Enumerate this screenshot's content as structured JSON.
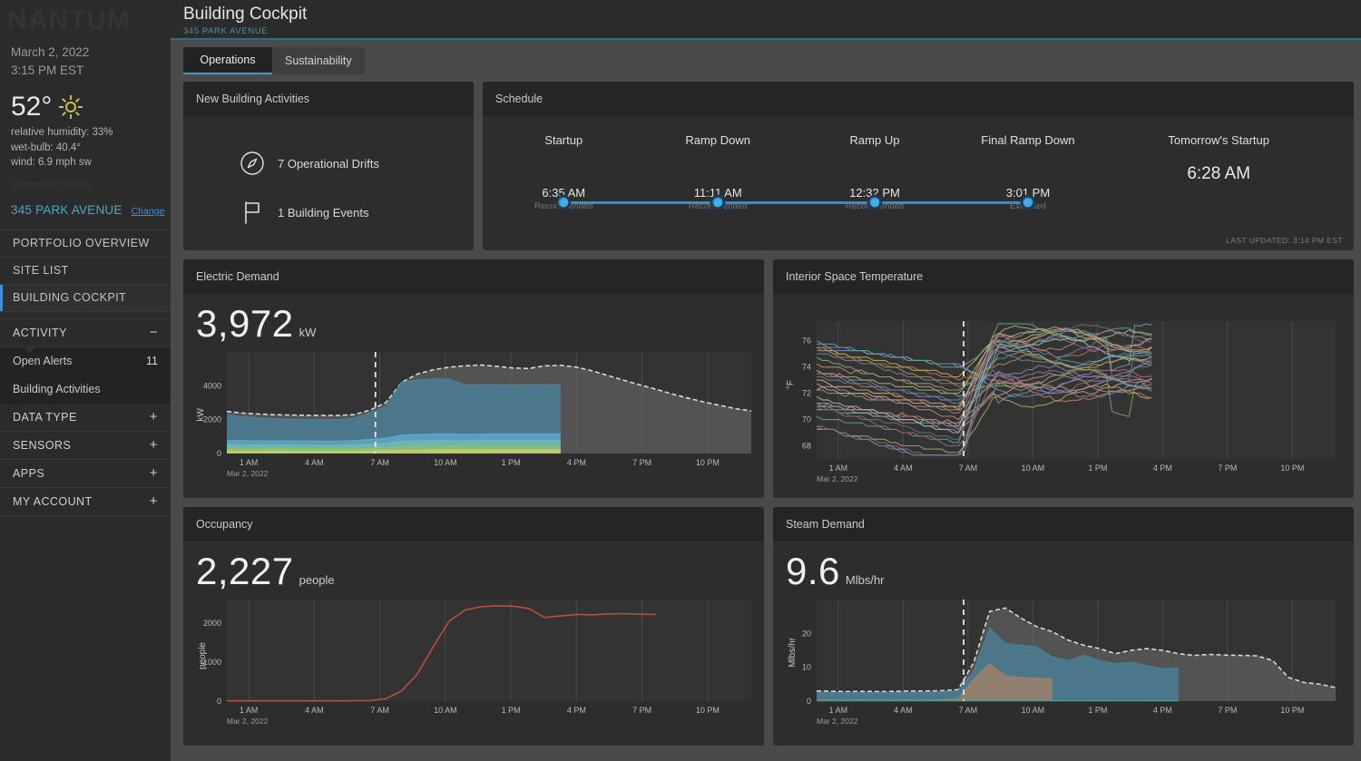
{
  "sidebar": {
    "logo": "NANTUM",
    "date": "March 2, 2022",
    "time": "3:15 PM EST",
    "weather": {
      "temp": "52°",
      "icon": "sun-icon",
      "humidity": "relative humidity: 33%",
      "wetbulb": "wet-bulb: 40.4°",
      "wind": "wind: 6.9 mph sw",
      "credit": "*powered by Dark Sky"
    },
    "site": {
      "name": "345 PARK AVENUE",
      "change": "Change"
    },
    "nav": [
      {
        "label": "PORTFOLIO OVERVIEW",
        "active": false
      },
      {
        "label": "SITE LIST",
        "active": false
      },
      {
        "label": "BUILDING COCKPIT",
        "active": true
      }
    ],
    "sections": [
      {
        "label": "ACTIVITY",
        "toggle": "−",
        "expanded": true,
        "items": [
          {
            "label": "Open Alerts",
            "count": "11"
          },
          {
            "label": "Building Activities",
            "count": ""
          }
        ]
      },
      {
        "label": "DATA TYPE",
        "toggle": "+",
        "expanded": false,
        "items": []
      },
      {
        "label": "SENSORS",
        "toggle": "+",
        "expanded": false,
        "items": []
      },
      {
        "label": "APPS",
        "toggle": "+",
        "expanded": false,
        "items": []
      },
      {
        "label": "MY ACCOUNT",
        "toggle": "+",
        "expanded": false,
        "items": []
      }
    ]
  },
  "header": {
    "title": "Building Cockpit",
    "subtitle": "345 PARK AVENUE"
  },
  "tabs": [
    {
      "label": "Operations",
      "active": true
    },
    {
      "label": "Sustainability",
      "active": false
    }
  ],
  "activities": {
    "title": "New Building Activities",
    "rows": [
      {
        "icon": "compass-icon",
        "label": "7 Operational Drifts"
      },
      {
        "icon": "flag-icon",
        "label": "1 Building Events"
      }
    ]
  },
  "schedule": {
    "title": "Schedule",
    "last_updated": "LAST UPDATED: 3:14 PM EST",
    "events": [
      {
        "name": "Startup",
        "time": "6:35 AM",
        "state": "Recommended"
      },
      {
        "name": "Ramp Down",
        "time": "11:11 AM",
        "state": "Recommended"
      },
      {
        "name": "Ramp Up",
        "time": "12:32 PM",
        "state": "Recommended"
      },
      {
        "name": "Final Ramp Down",
        "time": "3:01 PM",
        "state": "Executed"
      }
    ],
    "tomorrow": {
      "name": "Tomorrow's Startup",
      "time": "6:28 AM"
    }
  },
  "colors": {
    "accent_blue": "#3d9bd6",
    "track_blue": "#2e90cf",
    "site_teal": "#4ba8c4",
    "sidebar_bg": "#2b2b2b",
    "card_bg": "#2d2d2d",
    "card_header_bg": "#252525",
    "main_bg": "#4a4a4a",
    "occupancy_line": "#b5503f",
    "forecast_gray": "#6e6e6e"
  },
  "chart_data": [
    {
      "type": "area",
      "id": "electric-demand",
      "title": "Electric Demand",
      "value": "3,972",
      "unit": "kW",
      "ylabel": "kW",
      "xlabel": "",
      "date_label": "Mar 2, 2022",
      "ylim": [
        0,
        6000
      ],
      "yticks": [
        0,
        2000,
        4000
      ],
      "ytick_labels": [
        "0",
        "2000",
        "4000"
      ],
      "xticks": [
        "1 AM",
        "4 AM",
        "7 AM",
        "10 AM",
        "1 PM",
        "4 PM",
        "7 PM",
        "10 PM"
      ],
      "grid": true,
      "now_marker": "7 AM",
      "series": [
        {
          "name": "Forecast Total",
          "style": "dashed-area",
          "color": "#6e6e6e",
          "values": [
            2480,
            2390,
            2330,
            2290,
            2270,
            2255,
            2250,
            2245,
            2300,
            2560,
            3000,
            4200,
            4700,
            4950,
            5100,
            5180,
            5230,
            5150,
            5050,
            5020,
            5180,
            5210,
            5100,
            4880,
            4600,
            4320,
            4050,
            3800,
            3520,
            3280,
            3050,
            2850,
            2650,
            2520
          ]
        },
        {
          "name": "Actual Total",
          "style": "area",
          "color": "#4a7f96",
          "values": [
            2300,
            2180,
            2100,
            2050,
            2020,
            2010,
            2005,
            2000,
            2100,
            2400,
            2780,
            4200,
            4350,
            4400,
            4400,
            4050,
            4060,
            4060,
            4055,
            4060,
            4060,
            4050,
            null,
            null,
            null,
            null,
            null,
            null,
            null,
            null,
            null,
            null,
            null,
            null
          ]
        },
        {
          "name": "Sub-load A",
          "style": "area",
          "color": "#5fa8cc",
          "values": [
            780,
            760,
            750,
            745,
            740,
            735,
            730,
            730,
            760,
            820,
            900,
            1080,
            1120,
            1150,
            1160,
            1130,
            1140,
            1150,
            1150,
            1155,
            1160,
            1150,
            null,
            null,
            null,
            null,
            null,
            null,
            null,
            null,
            null,
            null,
            null,
            null
          ]
        },
        {
          "name": "Sub-load B",
          "style": "area",
          "color": "#6fb9b0",
          "values": [
            520,
            510,
            500,
            495,
            490,
            488,
            486,
            485,
            500,
            540,
            600,
            720,
            740,
            760,
            765,
            755,
            760,
            765,
            768,
            770,
            772,
            770,
            null,
            null,
            null,
            null,
            null,
            null,
            null,
            null,
            null,
            null,
            null,
            null
          ]
        },
        {
          "name": "Sub-load C",
          "style": "area",
          "color": "#8fbf6e",
          "values": [
            300,
            295,
            290,
            288,
            285,
            283,
            282,
            280,
            290,
            310,
            345,
            410,
            420,
            430,
            432,
            428,
            430,
            432,
            434,
            436,
            438,
            436,
            null,
            null,
            null,
            null,
            null,
            null,
            null,
            null,
            null,
            null,
            null,
            null
          ]
        },
        {
          "name": "Sub-load D",
          "style": "area",
          "color": "#c9c96e",
          "values": [
            140,
            138,
            135,
            134,
            132,
            131,
            130,
            130,
            135,
            145,
            160,
            190,
            195,
            200,
            202,
            200,
            201,
            202,
            203,
            204,
            205,
            204,
            null,
            null,
            null,
            null,
            null,
            null,
            null,
            null,
            null,
            null,
            null,
            null
          ]
        }
      ]
    },
    {
      "type": "line",
      "id": "interior-space-temperature",
      "title": "Interior Space Temperature",
      "value": "",
      "unit": "",
      "ylabel": "°F",
      "xlabel": "",
      "date_label": "Mar 2, 2022",
      "ylim": [
        67,
        77.5
      ],
      "yticks": [
        68,
        70,
        72,
        74,
        76
      ],
      "ytick_labels": [
        "68",
        "70",
        "72",
        "74",
        "76"
      ],
      "xticks": [
        "1 AM",
        "4 AM",
        "7 AM",
        "10 AM",
        "1 PM",
        "4 PM",
        "7 PM",
        "10 PM"
      ],
      "grid": true,
      "now_marker": "7 AM",
      "note": "~30 zone temperature traces; decline overnight then step up after 7 AM startup",
      "series_count": 30,
      "series_colors": [
        "#3f8fa8",
        "#c07a6a",
        "#b06a7a",
        "#7a9a5a",
        "#c0a850",
        "#8a7ab0",
        "#d08a6a",
        "#5a9a8a",
        "#a8606a",
        "#6a8ac0",
        "#c0b070",
        "#9a5a7a",
        "#70a090",
        "#b09060",
        "#8090b0",
        "#a0a060",
        "#60a0a0",
        "#c08090",
        "#7090a0",
        "#a0b070",
        "#b07060",
        "#6a7a9a",
        "#90a080",
        "#c0a090",
        "#708090",
        "#a09050",
        "#80b0a0",
        "#b08080",
        "#607080",
        "#9ab0c0"
      ],
      "trace_sample": {
        "overnight_start_range": [
          69.2,
          76.0
        ],
        "overnight_end_range": [
          67.6,
          74.2
        ],
        "post_startup_range": [
          71.5,
          77.0
        ],
        "afternoon_range": [
          70.8,
          77.2
        ]
      }
    },
    {
      "type": "line",
      "id": "occupancy",
      "title": "Occupancy",
      "value": "2,227",
      "unit": "people",
      "ylabel": "people",
      "xlabel": "",
      "date_label": "Mar 2, 2022",
      "ylim": [
        0,
        2600
      ],
      "yticks": [
        0,
        1000,
        2000
      ],
      "ytick_labels": [
        "0",
        "1000",
        "2000"
      ],
      "xticks": [
        "1 AM",
        "4 AM",
        "7 AM",
        "10 AM",
        "1 PM",
        "4 PM",
        "7 PM",
        "10 PM"
      ],
      "grid": true,
      "line_color": "#b5503f",
      "series": [
        {
          "name": "People",
          "color": "#b5503f",
          "values": [
            8,
            8,
            8,
            8,
            8,
            8,
            8,
            8,
            10,
            15,
            60,
            260,
            700,
            1400,
            2050,
            2330,
            2420,
            2440,
            2430,
            2370,
            2140,
            2180,
            2220,
            2210,
            2230,
            2240,
            2225,
            2220,
            null,
            null,
            null,
            null,
            null,
            null
          ]
        }
      ]
    },
    {
      "type": "area",
      "id": "steam-demand",
      "title": "Steam Demand",
      "value": "9.6",
      "unit": "Mlbs/hr",
      "ylabel": "Mlbs/hr",
      "xlabel": "",
      "date_label": "Mar 2, 2022",
      "ylim": [
        0,
        30
      ],
      "yticks": [
        0,
        10,
        20
      ],
      "ytick_labels": [
        "0",
        "10",
        "20"
      ],
      "xticks": [
        "1 AM",
        "4 AM",
        "7 AM",
        "10 AM",
        "1 PM",
        "4 PM",
        "7 PM",
        "10 PM"
      ],
      "grid": true,
      "now_marker": "7 AM",
      "series": [
        {
          "name": "Forecast Total",
          "style": "dashed-area",
          "color": "#6e6e6e",
          "values": [
            3.0,
            2.9,
            2.8,
            2.9,
            2.8,
            2.9,
            3.0,
            3.0,
            3.1,
            3.4,
            11.5,
            26.5,
            27.5,
            24.5,
            22.0,
            20.5,
            18.0,
            16.5,
            15.5,
            14.0,
            15.0,
            15.5,
            15.0,
            14.0,
            13.5,
            13.8,
            13.6,
            13.5,
            13.4,
            12.0,
            7.0,
            5.5,
            5.0,
            4.0
          ]
        },
        {
          "name": "Actual Blue",
          "style": "area",
          "color": "#4a7f96",
          "values": [
            2.6,
            2.5,
            2.5,
            2.5,
            2.5,
            2.5,
            2.6,
            2.6,
            2.7,
            3.0,
            9.0,
            21.5,
            17.0,
            16.5,
            16.0,
            13.0,
            12.0,
            13.5,
            12.0,
            11.0,
            11.5,
            10.5,
            9.5,
            9.8,
            null,
            null,
            null,
            null,
            null,
            null,
            null,
            null,
            null,
            null
          ]
        },
        {
          "name": "Actual Tan",
          "style": "area",
          "color": "#a08068",
          "values": [
            0.3,
            0.3,
            0.3,
            0.3,
            0.3,
            0.3,
            0.3,
            0.3,
            0.4,
            0.6,
            6.5,
            11.0,
            7.5,
            7.0,
            6.8,
            6.5,
            null,
            null,
            null,
            null,
            null,
            null,
            null,
            null,
            null,
            null,
            null,
            null,
            null,
            null,
            null,
            null,
            null,
            null
          ]
        },
        {
          "name": "Baseline Teal",
          "style": "line",
          "color": "#4f9a8a",
          "values": [
            0.1,
            0.1,
            0.1,
            0.1,
            0.1,
            0.1,
            0.1,
            0.1,
            0.1,
            0.1,
            0.1,
            0.1,
            0.1,
            0.1,
            0.1,
            0.1,
            0.1,
            0.1,
            0.1,
            0.1,
            0.1,
            0.1,
            0.1,
            0.1,
            null,
            null,
            null,
            null,
            null,
            null,
            null,
            null,
            null,
            null
          ]
        }
      ]
    }
  ]
}
